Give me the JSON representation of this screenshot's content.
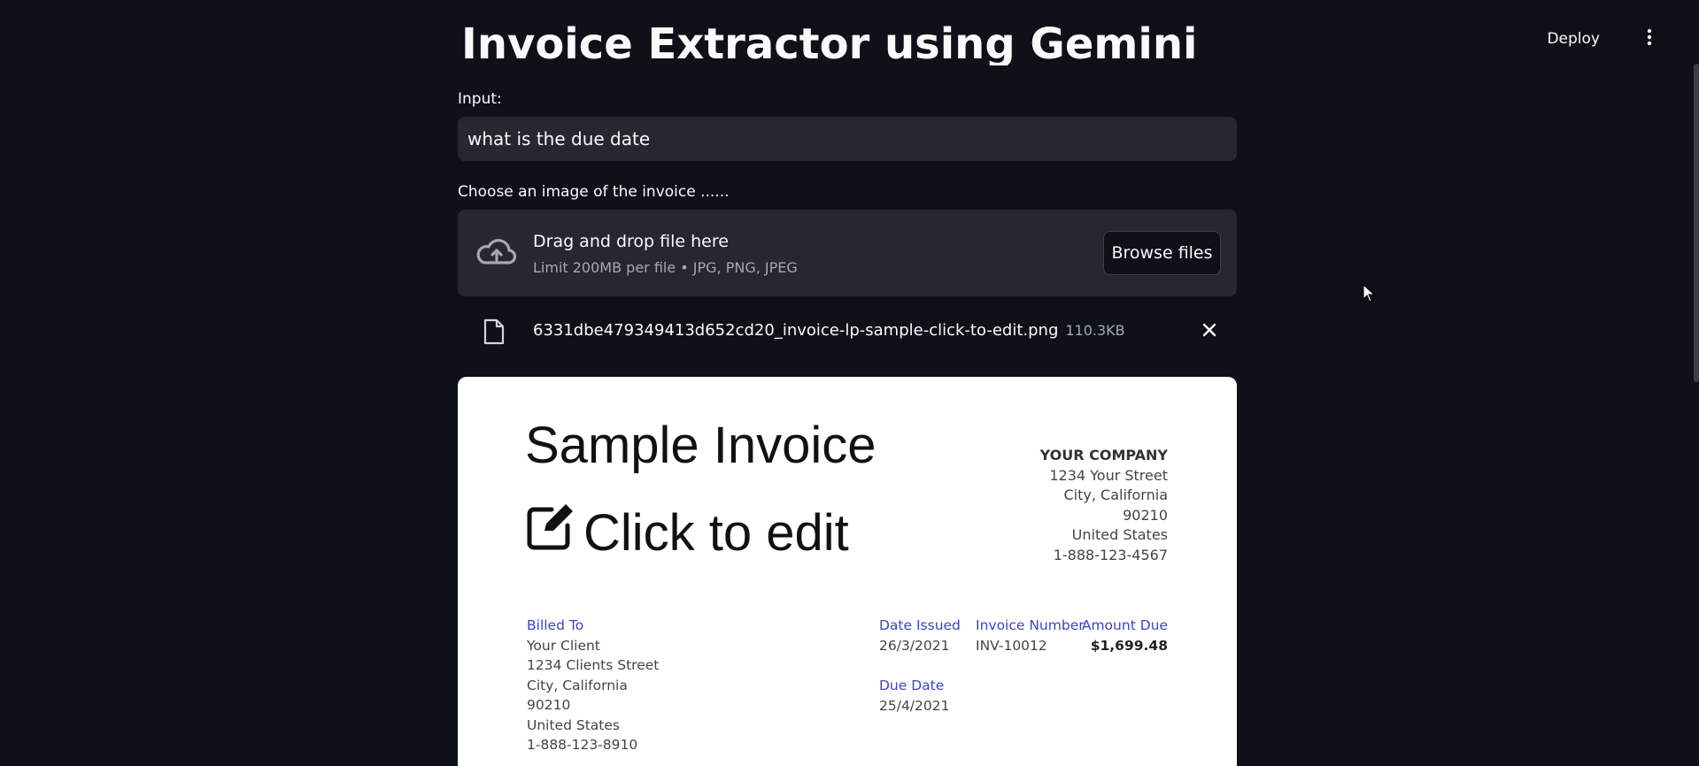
{
  "header": {
    "deploy_label": "Deploy",
    "menu_icon": "kebab-menu-icon"
  },
  "page": {
    "title": "Invoice Extractor using Gemini"
  },
  "input": {
    "label": "Input:",
    "value": "what is the due date"
  },
  "uploader": {
    "label": "Choose an image of the invoice ......",
    "drop_title": "Drag and drop file here",
    "drop_limit": "Limit 200MB per file • JPG, PNG, JPEG",
    "browse_label": "Browse files",
    "icon": "cloud-upload-icon"
  },
  "file": {
    "name": "6331dbe479349413d652cd20_invoice-lp-sample-click-to-edit.png",
    "size": "110.3KB",
    "icon": "file-icon",
    "remove_icon": "close-icon"
  },
  "invoice": {
    "title": "Sample Invoice",
    "edit_text": "Click to edit",
    "company": {
      "name": "YOUR COMPANY",
      "street": "1234 Your Street",
      "city": "City, California",
      "zip": "90210",
      "country": "United States",
      "phone": "1-888-123-4567"
    },
    "billed_to": {
      "heading": "Billed To",
      "name": "Your Client",
      "street": "1234 Clients Street",
      "city": "City, California",
      "zip": "90210",
      "country": "United States",
      "phone": "1-888-123-8910"
    },
    "date_issued": {
      "heading": "Date Issued",
      "value": "26/3/2021"
    },
    "invoice_number": {
      "heading": "Invoice Number",
      "value": "INV-10012"
    },
    "amount_due": {
      "heading": "Amount Due",
      "value": "$1,699.48"
    },
    "due_date": {
      "heading": "Due Date",
      "value": "25/4/2021"
    }
  },
  "colors": {
    "background": "#0e1117",
    "surface": "#262730",
    "accent_blue": "#3b46c2"
  }
}
